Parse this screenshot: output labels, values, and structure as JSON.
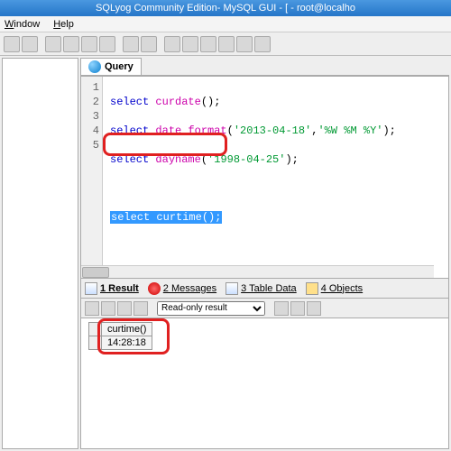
{
  "title": "SQLyog Community Edition- MySQL GUI - [ - root@localho",
  "menus": {
    "window": "Window",
    "help": "Help"
  },
  "queryTab": "Query",
  "editor": {
    "lines": [
      "1",
      "2",
      "3",
      "4",
      "5"
    ],
    "l1_kw": "select",
    "l1_fn": "curdate",
    "l1_rest": "();",
    "l2_kw": "select",
    "l2_fn": "date_format",
    "l2_p1": "(",
    "l2_s1": "'2013-04-18'",
    "l2_c1": ",",
    "l2_s2": "'%W %M %Y'",
    "l2_p2": ");",
    "l3_kw": "select",
    "l3_fn": "dayname",
    "l3_p1": "(",
    "l3_s1": "'1998-04-25'",
    "l3_p2": ");",
    "l5_kw": "select",
    "l5_fn": "curtime",
    "l5_rest": "();"
  },
  "resultTabs": {
    "result": "1 Result",
    "messages": "2 Messages",
    "tabledata": "3 Table Data",
    "objects": "4 Objects"
  },
  "resultTools": {
    "mode": "Read-only result"
  },
  "grid": {
    "col1": "curtime()",
    "val1": "14:28:18"
  }
}
